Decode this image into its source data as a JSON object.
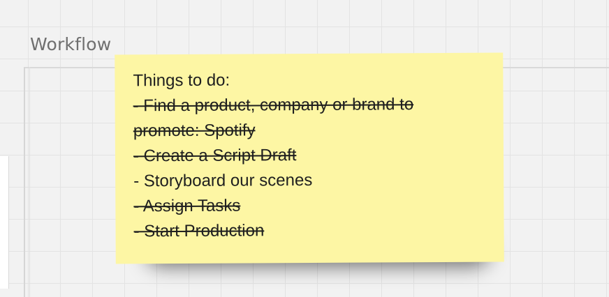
{
  "frame": {
    "title": "Workflow"
  },
  "sticky_note": {
    "color": "#fdf6a4",
    "lines": [
      {
        "text": "Things to do:",
        "struck": false
      },
      {
        "text": "- Find a product, company or brand to",
        "struck": true
      },
      {
        "text": "promote: Spotify",
        "struck": true
      },
      {
        "text": "- Create a Script Draft",
        "struck": true
      },
      {
        "text": "- Storyboard our scenes",
        "struck": false
      },
      {
        "text": "- Assign Tasks",
        "struck": true
      },
      {
        "text": "- Start Production",
        "struck": true
      }
    ]
  }
}
